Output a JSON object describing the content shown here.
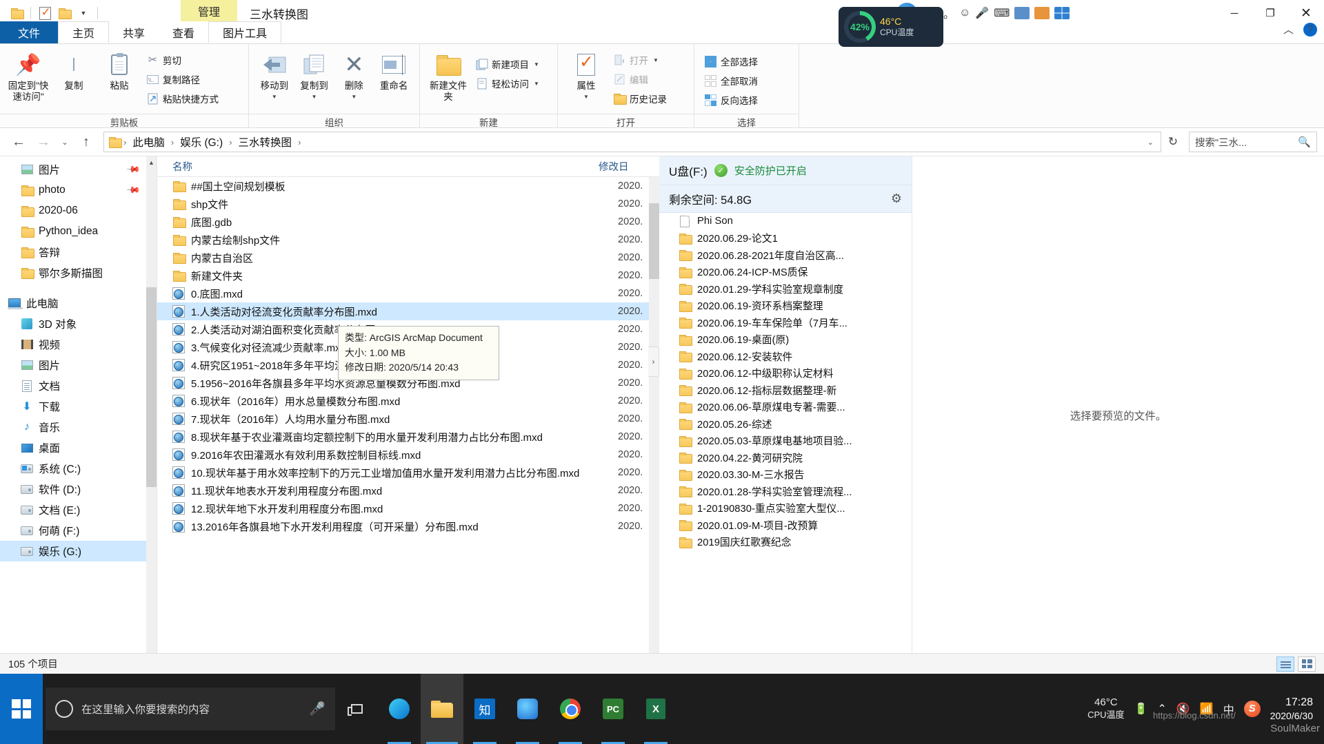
{
  "titlebar": {
    "quick_access": [
      "folder-icon",
      "checklist-icon",
      "folder-icon",
      "chevron-down-icon"
    ],
    "management_tab": "管理",
    "window_title": "三水转换图",
    "minimize": "─",
    "maximize": "❐",
    "close": "✕"
  },
  "ime": {
    "logo": "S",
    "mode": "中",
    "punct": "，。",
    "emoji": "☺",
    "mic": "🎤",
    "keyboard": "⌨",
    "tools": "🧰"
  },
  "cpu_overlay": {
    "percent": "42%",
    "temp": "46°C",
    "label": "CPU温度"
  },
  "tabs": {
    "file": "文件",
    "home": "主页",
    "share": "共享",
    "view": "查看",
    "picture_tools": "图片工具",
    "collapse": "︿",
    "help": "?"
  },
  "ribbon": {
    "groups": [
      {
        "label": "剪贴板",
        "big_buttons": [
          {
            "name": "pin-to-quick-access",
            "label": "固定到\"快速访问\"",
            "icon": "pin-icon"
          },
          {
            "name": "copy",
            "label": "复制",
            "icon": "copy-icon"
          },
          {
            "name": "paste",
            "label": "粘贴",
            "icon": "paste-icon"
          }
        ],
        "small_buttons": [
          {
            "name": "cut",
            "label": "剪切",
            "icon": "scissors-icon"
          },
          {
            "name": "copy-path",
            "label": "复制路径",
            "icon": "path-icon"
          },
          {
            "name": "paste-shortcut",
            "label": "粘贴快捷方式",
            "icon": "shortcut-icon"
          }
        ]
      },
      {
        "label": "组织",
        "big_buttons": [
          {
            "name": "move-to",
            "label": "移动到",
            "icon": "move-arrow-icon"
          },
          {
            "name": "copy-to",
            "label": "复制到",
            "icon": "copy-stack-icon"
          },
          {
            "name": "delete",
            "label": "删除",
            "icon": "x-icon"
          },
          {
            "name": "rename",
            "label": "重命名",
            "icon": "rename-icon"
          }
        ]
      },
      {
        "label": "新建",
        "big_buttons": [
          {
            "name": "new-folder",
            "label": "新建文件夹",
            "icon": "folder-icon"
          }
        ],
        "small_buttons": [
          {
            "name": "new-item",
            "label": "新建项目",
            "icon": "new-item-icon"
          },
          {
            "name": "easy-access",
            "label": "轻松访问",
            "icon": "easy-access-icon"
          }
        ]
      },
      {
        "label": "打开",
        "big_buttons": [
          {
            "name": "properties",
            "label": "属性",
            "icon": "properties-icon"
          }
        ],
        "small_buttons": [
          {
            "name": "open",
            "label": "打开",
            "icon": "open-icon",
            "dim": true
          },
          {
            "name": "edit",
            "label": "编辑",
            "icon": "edit-icon",
            "dim": true
          },
          {
            "name": "history",
            "label": "历史记录",
            "icon": "history-icon"
          }
        ]
      },
      {
        "label": "选择",
        "small_buttons": [
          {
            "name": "select-all",
            "label": "全部选择",
            "icon": "select-all-icon"
          },
          {
            "name": "select-none",
            "label": "全部取消",
            "icon": "select-none-icon"
          },
          {
            "name": "invert-selection",
            "label": "反向选择",
            "icon": "invert-selection-icon"
          }
        ]
      }
    ]
  },
  "addressbar": {
    "back": "←",
    "forward": "→",
    "recent": "⌄",
    "up": "↑",
    "breadcrumbs": [
      "此电脑",
      "娱乐 (G:)",
      "三水转换图"
    ],
    "separator": "›",
    "refresh": "↻",
    "search_placeholder": "搜索\"三水...",
    "search_icon": "search-icon"
  },
  "sidebar": {
    "quick_access": [
      {
        "label": "图片",
        "icon": "picture-icon",
        "pinned": true
      },
      {
        "label": "photo",
        "icon": "folder-icon",
        "pinned": true
      },
      {
        "label": "2020-06",
        "icon": "folder-icon"
      },
      {
        "label": "Python_idea",
        "icon": "folder-icon"
      },
      {
        "label": "答辩",
        "icon": "folder-icon"
      },
      {
        "label": "鄂尔多斯描图",
        "icon": "folder-icon"
      }
    ],
    "this_pc": {
      "label": "此电脑",
      "icon": "computer-icon"
    },
    "this_pc_items": [
      {
        "label": "3D 对象",
        "icon": "cube-icon"
      },
      {
        "label": "视频",
        "icon": "video-icon"
      },
      {
        "label": "图片",
        "icon": "picture-icon"
      },
      {
        "label": "文档",
        "icon": "document-icon"
      },
      {
        "label": "下载",
        "icon": "download-icon"
      },
      {
        "label": "音乐",
        "icon": "music-icon"
      },
      {
        "label": "桌面",
        "icon": "desktop-icon"
      },
      {
        "label": "系统 (C:)",
        "icon": "system-drive-icon"
      },
      {
        "label": "软件 (D:)",
        "icon": "drive-icon"
      },
      {
        "label": "文档 (E:)",
        "icon": "drive-icon"
      },
      {
        "label": "何萌 (F:)",
        "icon": "drive-icon"
      },
      {
        "label": "娱乐 (G:)",
        "icon": "drive-icon",
        "selected": true
      }
    ]
  },
  "filelist": {
    "columns": {
      "name": "名称",
      "date": "修改日"
    },
    "rows": [
      {
        "name": "##国土空间规划模板",
        "icon": "folder-icon",
        "date": "2020."
      },
      {
        "name": "shp文件",
        "icon": "folder-icon",
        "date": "2020."
      },
      {
        "name": "底图.gdb",
        "icon": "folder-icon",
        "date": "2020."
      },
      {
        "name": "内蒙古绘制shp文件",
        "icon": "folder-icon",
        "date": "2020."
      },
      {
        "name": "内蒙古自治区",
        "icon": "folder-icon",
        "date": "2020."
      },
      {
        "name": "新建文件夹",
        "icon": "folder-icon",
        "date": "2020."
      },
      {
        "name": "0.底图.mxd",
        "icon": "mxd-icon",
        "date": "2020."
      },
      {
        "name": "1.人类活动对径流变化贡献率分布图.mxd",
        "icon": "mxd-icon",
        "date": "2020.",
        "selected": true
      },
      {
        "name": "2.人类活动对湖泊面积变化贡献率分布图.mxd",
        "icon": "mxd-icon",
        "date": "2020."
      },
      {
        "name": "3.气候变化对径流减少贡献率.mxd",
        "icon": "mxd-icon",
        "date": "2020."
      },
      {
        "name": "4.研究区1951~2018年多年平均温湿指数（舒适度）分布图.mxd",
        "icon": "mxd-icon",
        "date": "2020."
      },
      {
        "name": "5.1956~2016年各旗县多年平均水资源总量模数分布图.mxd",
        "icon": "mxd-icon",
        "date": "2020."
      },
      {
        "name": "6.现状年（2016年）用水总量模数分布图.mxd",
        "icon": "mxd-icon",
        "date": "2020."
      },
      {
        "name": "7.现状年（2016年）人均用水量分布图.mxd",
        "icon": "mxd-icon",
        "date": "2020."
      },
      {
        "name": "8.现状年基于农业灌溉亩均定额控制下的用水量开发利用潜力占比分布图.mxd",
        "icon": "mxd-icon",
        "date": "2020."
      },
      {
        "name": "9.2016年农田灌溉水有效利用系数控制目标线.mxd",
        "icon": "mxd-icon",
        "date": "2020."
      },
      {
        "name": "10.现状年基于用水效率控制下的万元工业增加值用水量开发利用潜力占比分布图.mxd",
        "icon": "mxd-icon",
        "date": "2020."
      },
      {
        "name": "11.现状年地表水开发利用程度分布图.mxd",
        "icon": "mxd-icon",
        "date": "2020."
      },
      {
        "name": "12.现状年地下水开发利用程度分布图.mxd",
        "icon": "mxd-icon",
        "date": "2020."
      },
      {
        "name": "13.2016年各旗县地下水开发利用程度（可开采量）分布图.mxd",
        "icon": "mxd-icon",
        "date": "2020."
      }
    ]
  },
  "tooltip": {
    "type": "类型: ArcGIS ArcMap Document",
    "size": "大小: 1.00 MB",
    "modified": "修改日期: 2020/5/14 20:43"
  },
  "splitter": {
    "icon": "chevron-right-icon",
    "glyph": "›"
  },
  "usb_panel": {
    "drive": "U盘(F:)",
    "shield_icon": "shield-icon",
    "protection": "安全防护已开启",
    "free_space": "剩余空间: 54.8G",
    "gear_icon": "gear-icon",
    "items": [
      {
        "name": "Phi Son",
        "icon": "file-icon"
      },
      {
        "name": "2020.06.29-论文1",
        "icon": "folder-icon"
      },
      {
        "name": "2020.06.28-2021年度自治区高...",
        "icon": "folder-icon"
      },
      {
        "name": "2020.06.24-ICP-MS质保",
        "icon": "folder-icon"
      },
      {
        "name": "2020.01.29-学科实验室规章制度",
        "icon": "folder-icon"
      },
      {
        "name": "2020.06.19-资环系档案整理",
        "icon": "folder-icon"
      },
      {
        "name": "2020.06.19-车车保险单（7月车...",
        "icon": "folder-icon"
      },
      {
        "name": "2020.06.19-桌面(原)",
        "icon": "folder-icon"
      },
      {
        "name": "2020.06.12-安装软件",
        "icon": "folder-icon"
      },
      {
        "name": "2020.06.12-中级职称认定材料",
        "icon": "folder-icon"
      },
      {
        "name": "2020.06.12-指标层数据整理-新",
        "icon": "folder-icon"
      },
      {
        "name": "2020.06.06-草原煤电专著-需要...",
        "icon": "folder-icon"
      },
      {
        "name": "2020.05.26-综述",
        "icon": "folder-icon"
      },
      {
        "name": "2020.05.03-草原煤电基地项目验...",
        "icon": "folder-icon"
      },
      {
        "name": "2020.04.22-黄河研究院",
        "icon": "folder-icon"
      },
      {
        "name": "2020.03.30-M-三水报告",
        "icon": "folder-icon"
      },
      {
        "name": "2020.01.28-学科实验室管理流程...",
        "icon": "folder-icon"
      },
      {
        "name": "1-20190830-重点实验室大型仪...",
        "icon": "folder-icon"
      },
      {
        "name": "2020.01.09-M-项目-改预算",
        "icon": "folder-icon"
      },
      {
        "name": "2019国庆红歌赛纪念",
        "icon": "folder-icon"
      }
    ]
  },
  "preview": {
    "message": "选择要预览的文件。"
  },
  "statusbar": {
    "count": "105 个项目",
    "view_details_icon": "details-view-icon",
    "view_tiles_icon": "tiles-view-icon"
  },
  "taskbar": {
    "start_icon": "windows-start-icon",
    "search_placeholder": "在这里输入你要搜索的内容",
    "search_circle_icon": "cortana-circle-icon",
    "mic_icon": "microphone-icon",
    "taskview_icon": "task-view-icon",
    "apps": [
      {
        "name": "edge",
        "icon": "edge-icon"
      },
      {
        "name": "file-explorer",
        "icon": "file-explorer-icon",
        "active": true
      },
      {
        "name": "zhihu",
        "icon": "zhihu-icon",
        "label": "知"
      },
      {
        "name": "firefox-like",
        "icon": "browser-icon"
      },
      {
        "name": "chrome",
        "icon": "chrome-icon"
      },
      {
        "name": "pycharm",
        "icon": "pycharm-icon",
        "label": "PC"
      },
      {
        "name": "excel",
        "icon": "excel-icon",
        "label": "X"
      }
    ],
    "tray": {
      "temp_value": "46°C",
      "temp_label": "CPU温度",
      "battery_icon": "battery-icon",
      "chevron_icon": "chevron-up-icon",
      "volume_icon": "volume-mute-icon",
      "network_icon": "network-icon",
      "ime_label": "中",
      "sogou_icon": "sogou-icon",
      "time": "17:28",
      "date": "2020/6/30"
    },
    "watermark_url": "https://blog.csdn.net/",
    "watermark_brand": "SoulMaker"
  }
}
